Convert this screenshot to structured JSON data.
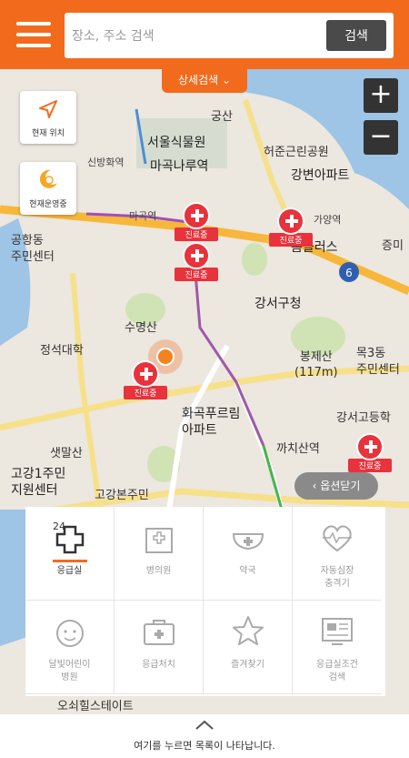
{
  "search": {
    "placeholder": "장소, 주소 검색",
    "button_label": "검색"
  },
  "detail_search_label": "상세검색 ⌄",
  "side_buttons": {
    "current_location": "현재 위치",
    "open_now": "현재운영중"
  },
  "zoom": {
    "in": "+",
    "out": "−"
  },
  "marker_tag": "진료중",
  "map_labels": {
    "gungsan": "궁산",
    "seoul_botanic_park": "서울식물원",
    "magoknaru_station": "마곡나루역",
    "sinbang_station": "신방화역",
    "heojun_park": "허준근린공원",
    "gangbyeon_apt": "강변아파트",
    "magok_station": "마곡역",
    "gayang_station": "가양역",
    "homeplus": "홈플러스",
    "jeungmi": "증미",
    "gonghang_center": "공항동\n주민센터",
    "gangseo_office": "강서구청",
    "sumyeongsan": "수명산",
    "jeongseok_univ": "정석대학",
    "bongjesan": "봉제산\n(117m)",
    "mok3_center": "목3동\n주민센터",
    "hwagok_purim_apt": "화곡푸르림\n아파트",
    "kkachisan_station": "까치산역",
    "gangseo_godeung": "강서고등학",
    "saetmalsan": "샛말산",
    "gogang1_center": "고강1주민\n지원센터",
    "gogangbon_center": "고강본주민",
    "ose_hill_estate": "오쇠힐스테이트",
    "route_6": "6"
  },
  "options_close_label": "옵션닫기",
  "categories": [
    {
      "label": "응급실",
      "icon": "emergency-24-icon",
      "active": true
    },
    {
      "label": "병의원",
      "icon": "hospital-icon",
      "active": false
    },
    {
      "label": "약국",
      "icon": "pharmacy-icon",
      "active": false
    },
    {
      "label": "자동심장\n충격기",
      "icon": "aed-heart-icon",
      "active": false
    },
    {
      "label": "달빛어린이\n병원",
      "icon": "moonlight-child-icon",
      "active": false
    },
    {
      "label": "응급처치",
      "icon": "first-aid-kit-icon",
      "active": false
    },
    {
      "label": "즐겨찾기",
      "icon": "star-icon",
      "active": false
    },
    {
      "label": "응급실조건\n검색",
      "icon": "condition-search-icon",
      "active": false
    }
  ],
  "bottom_hint": "여기를 누르면 목록이 나타납니다.",
  "colors": {
    "brand_orange": "#f26b1d",
    "marker_red": "#e8323c",
    "river": "#9ec4e6",
    "park_green": "#cfe3b4"
  }
}
